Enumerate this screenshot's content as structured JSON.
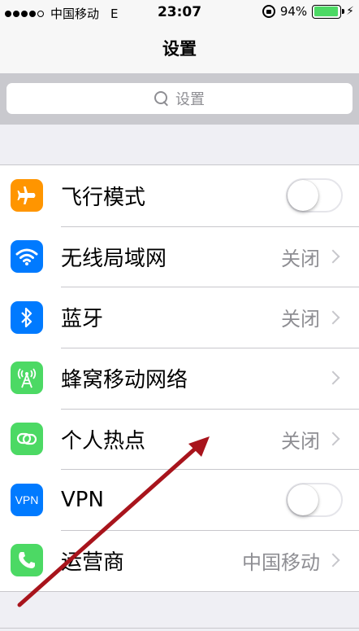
{
  "status_bar": {
    "carrier": "中国移动",
    "network": "E",
    "time": "23:07",
    "battery": "94%",
    "battery_level": 0.94,
    "battery_color": "#4cd964"
  },
  "nav": {
    "title": "设置"
  },
  "search": {
    "placeholder": "设置"
  },
  "rows": [
    {
      "label": "飞行模式",
      "icon": "airplane-icon",
      "icon_color": "#ff9500",
      "control": "toggle",
      "on": false
    },
    {
      "label": "无线局域网",
      "icon": "wifi-icon",
      "icon_color": "#007aff",
      "value": "关闭",
      "control": "chevron"
    },
    {
      "label": "蓝牙",
      "icon": "bluetooth-icon",
      "icon_color": "#007aff",
      "value": "关闭",
      "control": "chevron"
    },
    {
      "label": "蜂窝移动网络",
      "icon": "cellular-antenna-icon",
      "icon_color": "#4cd964",
      "control": "chevron"
    },
    {
      "label": "个人热点",
      "icon": "hotspot-icon",
      "icon_color": "#4cd964",
      "value": "关闭",
      "control": "chevron"
    },
    {
      "label": "VPN",
      "icon": "vpn-icon",
      "icon_color": "#007aff",
      "icon_text": "VPN",
      "control": "toggle",
      "on": false
    },
    {
      "label": "运营商",
      "icon": "phone-icon",
      "icon_color": "#4cd964",
      "value": "中国移动",
      "control": "chevron"
    }
  ],
  "annotation": {
    "arrow_color": "#a8141c"
  }
}
